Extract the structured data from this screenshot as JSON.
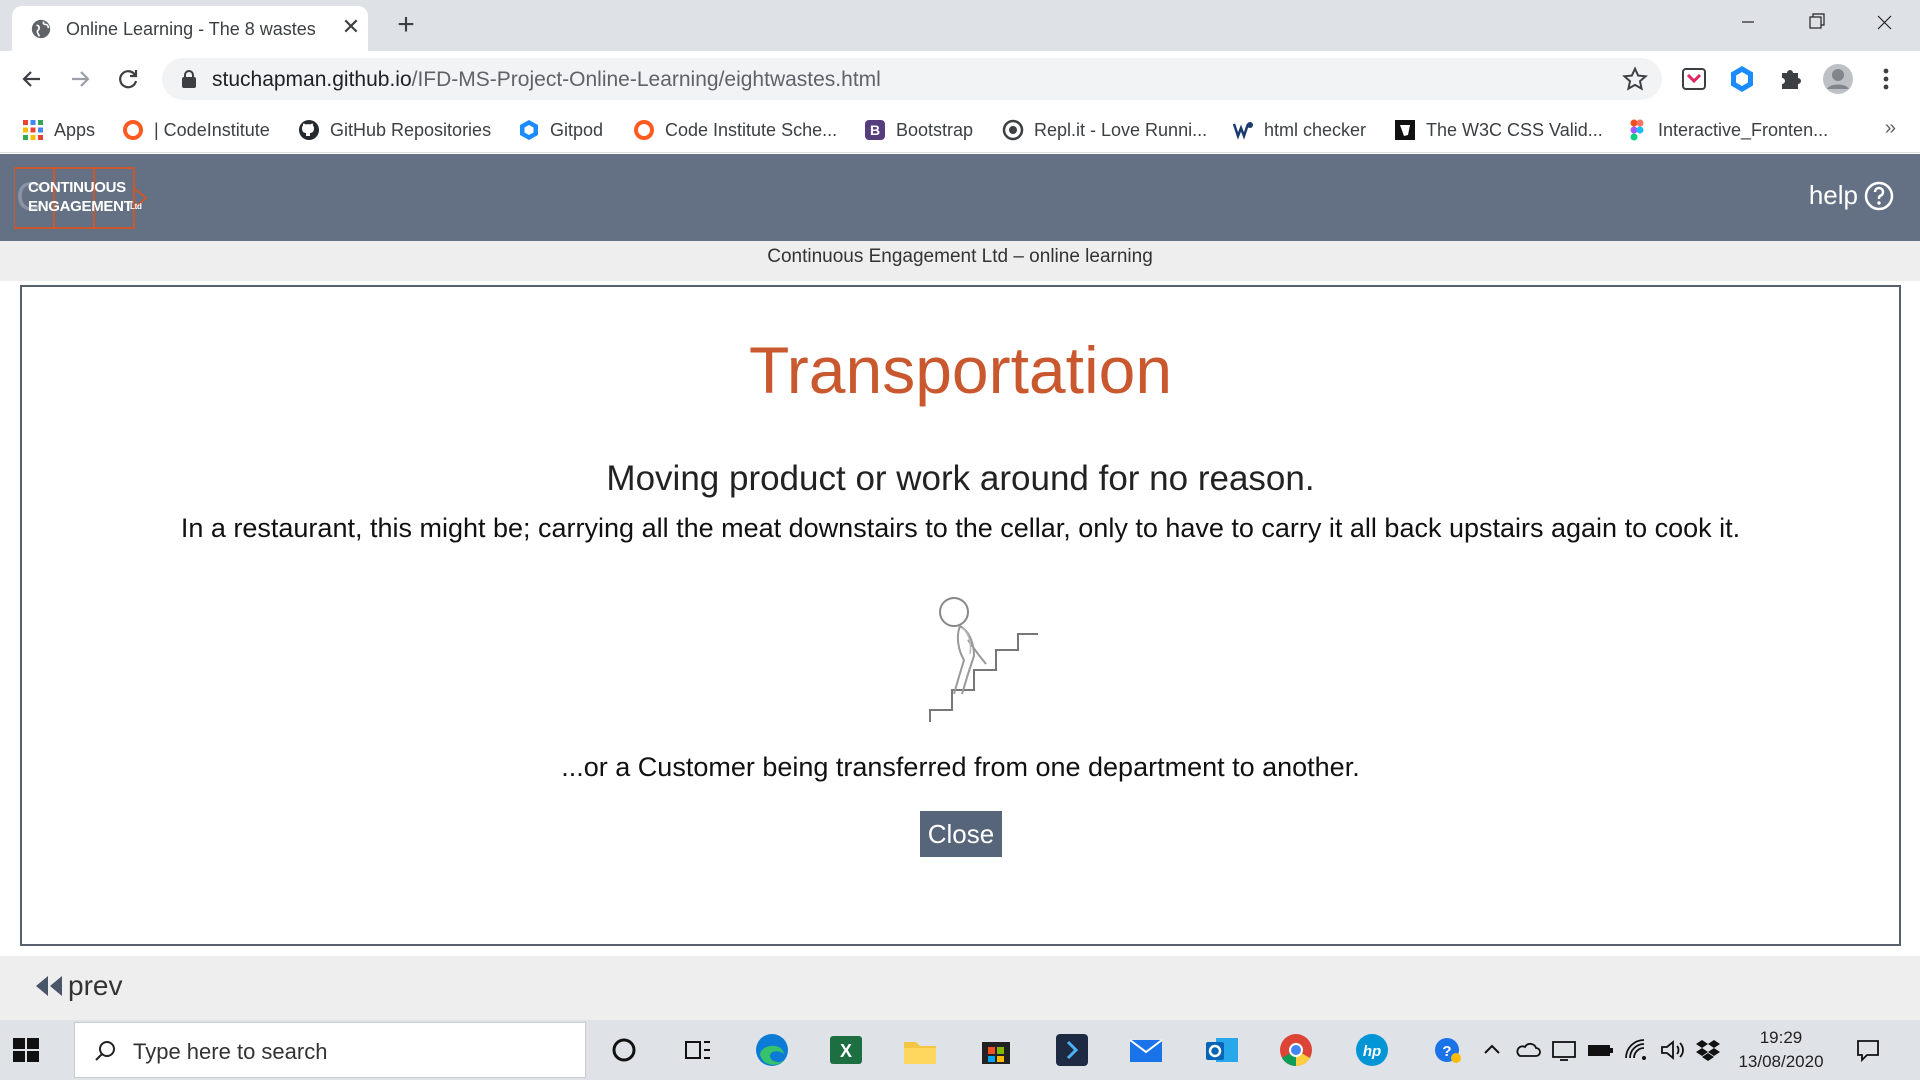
{
  "browser": {
    "tab_title": "Online Learning - The 8 wastes",
    "new_tab_label": "+",
    "url_host": "stuchapman.github.io",
    "url_path": "/IFD-MS-Project-Online-Learning/eightwastes.html",
    "bookmarks": [
      {
        "label": "Apps",
        "icon": "apps-grid-icon"
      },
      {
        "label": "| CodeInstitute",
        "icon": "codeinstitute-icon"
      },
      {
        "label": "GitHub Repositories",
        "icon": "github-icon"
      },
      {
        "label": "Gitpod",
        "icon": "gitpod-icon"
      },
      {
        "label": "Code Institute Sche...",
        "icon": "codeinstitute-icon"
      },
      {
        "label": "Bootstrap",
        "icon": "bootstrap-icon"
      },
      {
        "label": "Repl.it - Love Runni...",
        "icon": "replit-icon"
      },
      {
        "label": "html checker",
        "icon": "w3c-icon"
      },
      {
        "label": "The W3C CSS Valid...",
        "icon": "w3c-css-icon"
      },
      {
        "label": "Interactive_Fronten...",
        "icon": "figma-icon"
      }
    ],
    "bookmarks_overflow": "»"
  },
  "site": {
    "logo_line1": "CONTINUOUS",
    "logo_line2": "ENGAGEMENT",
    "logo_ltd": "Ltd",
    "help_label": "help",
    "subtitle": "Continuous Engagement Ltd – online learning"
  },
  "modal": {
    "title": "Transportation",
    "lead": "Moving product or work around for no reason.",
    "description": "In a restaurant, this might be; carrying all the meat downstairs to the cellar, only to have to carry it all back upstairs again to cook it.",
    "extra": "...or a Customer being transferred from one department to another.",
    "close_label": "Close"
  },
  "footer": {
    "prev_label": "prev"
  },
  "taskbar": {
    "search_placeholder": "Type here to search",
    "time": "19:29",
    "date": "13/08/2020"
  },
  "colors": {
    "header_bg": "#647184",
    "title_accent": "#c9582f",
    "button_bg": "#56657a"
  }
}
